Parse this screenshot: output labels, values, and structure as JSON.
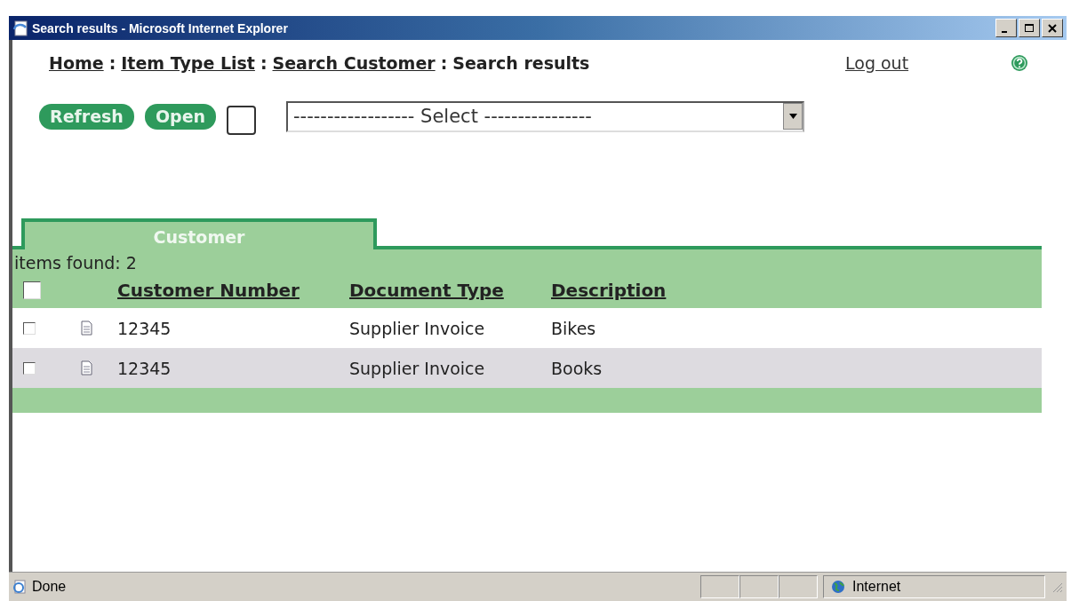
{
  "window": {
    "title": "Search results - Microsoft Internet Explorer"
  },
  "breadcrumbs": [
    {
      "label": "Home",
      "kind": "link"
    },
    {
      "label": "Item Type List",
      "kind": "link"
    },
    {
      "label": "Search Customer",
      "kind": "link"
    },
    {
      "label": "Search results",
      "kind": "current"
    }
  ],
  "breadcrumb_separator": ":",
  "logout": "Log out",
  "toolbar": {
    "buttons": [
      "Refresh",
      "Open"
    ],
    "checkbox": {
      "checked": false
    },
    "select": {
      "value": "------------------ Select ----------------"
    }
  },
  "tabs": [
    {
      "label": "Customer",
      "selected": true
    }
  ],
  "items_found": "items found: 2",
  "table": {
    "select_all": {
      "checked": false
    },
    "columns": [
      "Customer Number",
      "Document Type",
      "Description"
    ],
    "rows": [
      {
        "checked": false,
        "cells": [
          "12345",
          "Supplier Invoice",
          "Bikes"
        ]
      },
      {
        "checked": false,
        "cells": [
          "12345",
          "Supplier Invoice",
          "Books"
        ]
      }
    ]
  },
  "status_bar": {
    "text": "Done",
    "zone": "Internet"
  }
}
